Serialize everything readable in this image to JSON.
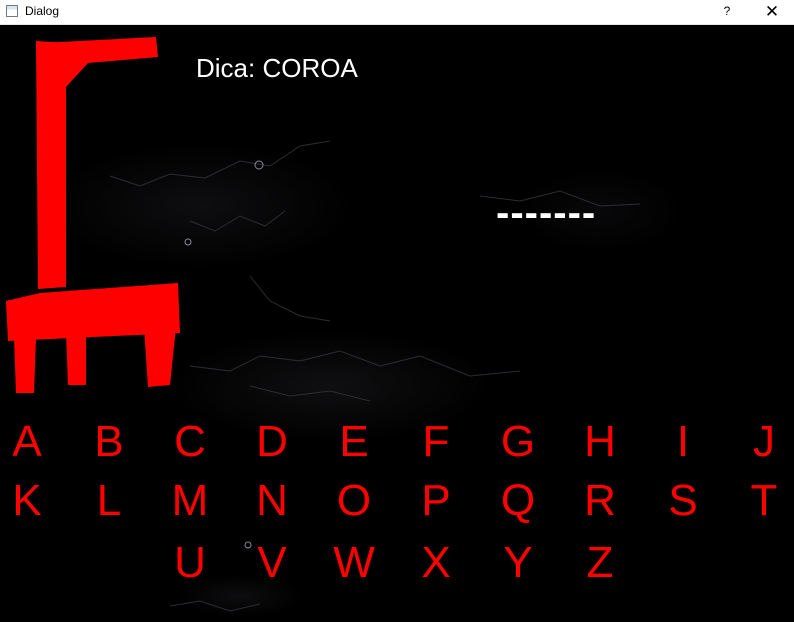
{
  "window": {
    "title": "Dialog",
    "help_label": "?",
    "close_label": "✕",
    "icon": "app-window-icon"
  },
  "game": {
    "hint": "Dica: COROA",
    "masked_word": "-------",
    "gallows_color": "#ff0000",
    "letter_color": "#ff0000",
    "keyboard": [
      [
        "A",
        "B",
        "C",
        "D",
        "E",
        "F",
        "G",
        "H",
        "I",
        "J"
      ],
      [
        "K",
        "L",
        "M",
        "N",
        "O",
        "P",
        "Q",
        "R",
        "S",
        "T"
      ],
      [
        "U",
        "V",
        "W",
        "X",
        "Y",
        "Z"
      ]
    ]
  }
}
